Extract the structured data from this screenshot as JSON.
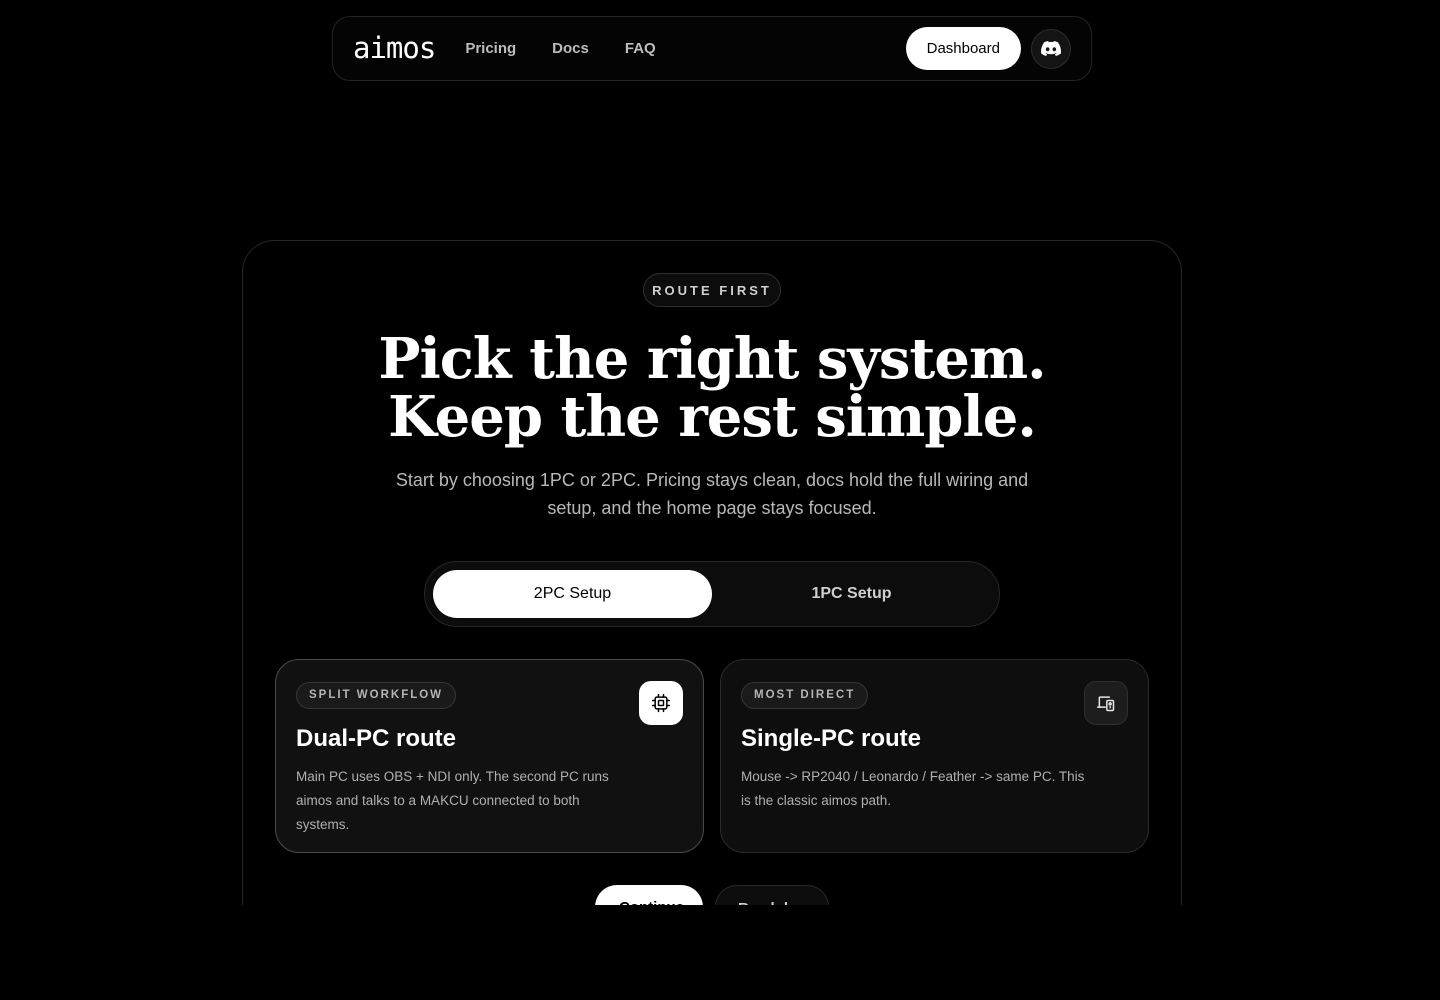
{
  "nav": {
    "logo": "aimos",
    "links": [
      "Pricing",
      "Docs",
      "FAQ"
    ],
    "dashboard_label": "Dashboard",
    "discord_icon": "discord-icon"
  },
  "hero": {
    "badge": "ROUTE FIRST",
    "title_line1": "Pick the right system.",
    "title_line2": "Keep the rest simple.",
    "subtitle": "Start by choosing 1PC or 2PC. Pricing stays clean, docs hold the full wiring and setup, and the home page stays focused."
  },
  "toggle": {
    "options": [
      "2PC Setup",
      "1PC Setup"
    ],
    "selected": "2PC Setup"
  },
  "routes": [
    {
      "badge": "SPLIT WORKFLOW",
      "title": "Dual-PC route",
      "description": "Main PC uses OBS + NDI only. The second PC runs aimos and talks to a MAKCU connected to both systems.",
      "icon": "chip-icon",
      "selected": true
    },
    {
      "badge": "MOST DIRECT",
      "title": "Single-PC route",
      "description": "Mouse -> RP2040 / Leonardo / Feather -> same PC. This is the classic aimos path.",
      "icon": "devices-icon",
      "selected": false
    }
  ],
  "bottom_pills": [
    "Continue",
    "Read docs"
  ],
  "colors": {
    "background": "#000000",
    "accent": "#ffffff",
    "muted_text": "#b8b8b8"
  }
}
